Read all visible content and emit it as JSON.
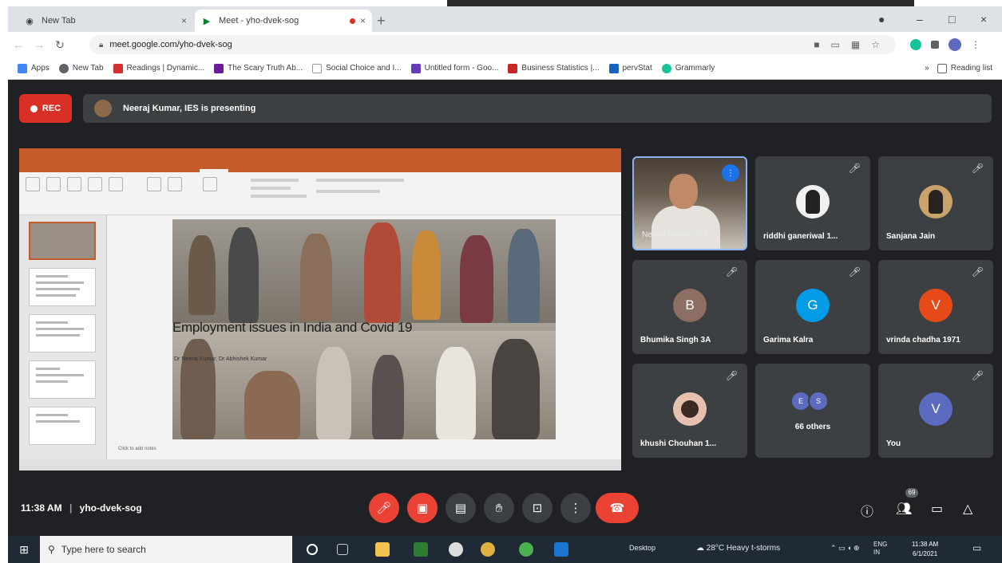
{
  "browser": {
    "tabs": [
      {
        "title": "New Tab",
        "close": "×"
      },
      {
        "title": "Meet - yho-dvek-sog",
        "close": "×"
      }
    ],
    "new_tab": "+",
    "window_controls": {
      "minimize": "–",
      "maximize": "□",
      "close": "×"
    },
    "url": "meet.google.com/yho-dvek-sog",
    "nav": {
      "back": "←",
      "forward": "→",
      "reload": "↻"
    },
    "bookmarks": [
      "Apps",
      "New Tab",
      "Readings | Dynamic...",
      "The Scary Truth Ab...",
      "Social Choice and I...",
      "Untitled form - Goo...",
      "Business Statistics |...",
      "pervStat",
      "Grammarly"
    ],
    "reading_list": "Reading list"
  },
  "meet": {
    "rec_label": "REC",
    "presenting_text": "Neeraj Kumar, IES is presenting",
    "presentation": {
      "slide_title": "Employment issues in India and Covid 19",
      "slide_subtitle": "Dr Neeraj Kumar, Dr Abhishek Kumar",
      "notes": "Click to add notes"
    },
    "participants": [
      {
        "name": "Neeraj Kumar, IES",
        "type": "video",
        "speaking": true
      },
      {
        "name": "riddhi ganeriwal 1...",
        "type": "photo"
      },
      {
        "name": "Sanjana Jain",
        "type": "photo"
      },
      {
        "name": "Bhumika Singh 3A",
        "type": "letter",
        "letter": "B",
        "color": "#8d6e63"
      },
      {
        "name": "Garima Kalra",
        "type": "letter",
        "letter": "G",
        "color": "#039be5"
      },
      {
        "name": "vrinda chadha 1971",
        "type": "letter",
        "letter": "V",
        "color": "#e64a19"
      },
      {
        "name": "khushi Chouhan 1...",
        "type": "photo"
      },
      {
        "name": "66 others",
        "type": "others",
        "letters": [
          "E",
          "S"
        ]
      },
      {
        "name": "You",
        "type": "letter",
        "letter": "V",
        "color": "#5c6bc0"
      }
    ],
    "meeting_time": "11:38 AM",
    "meeting_code": "yho-dvek-sog",
    "people_count": "69"
  },
  "taskbar": {
    "search_placeholder": "Type here to search",
    "weather": "28°C Heavy t-storms",
    "time": "11:38 AM",
    "date": "6/1/2021",
    "lang": "ENG IN",
    "desktop_label": "Desktop"
  }
}
